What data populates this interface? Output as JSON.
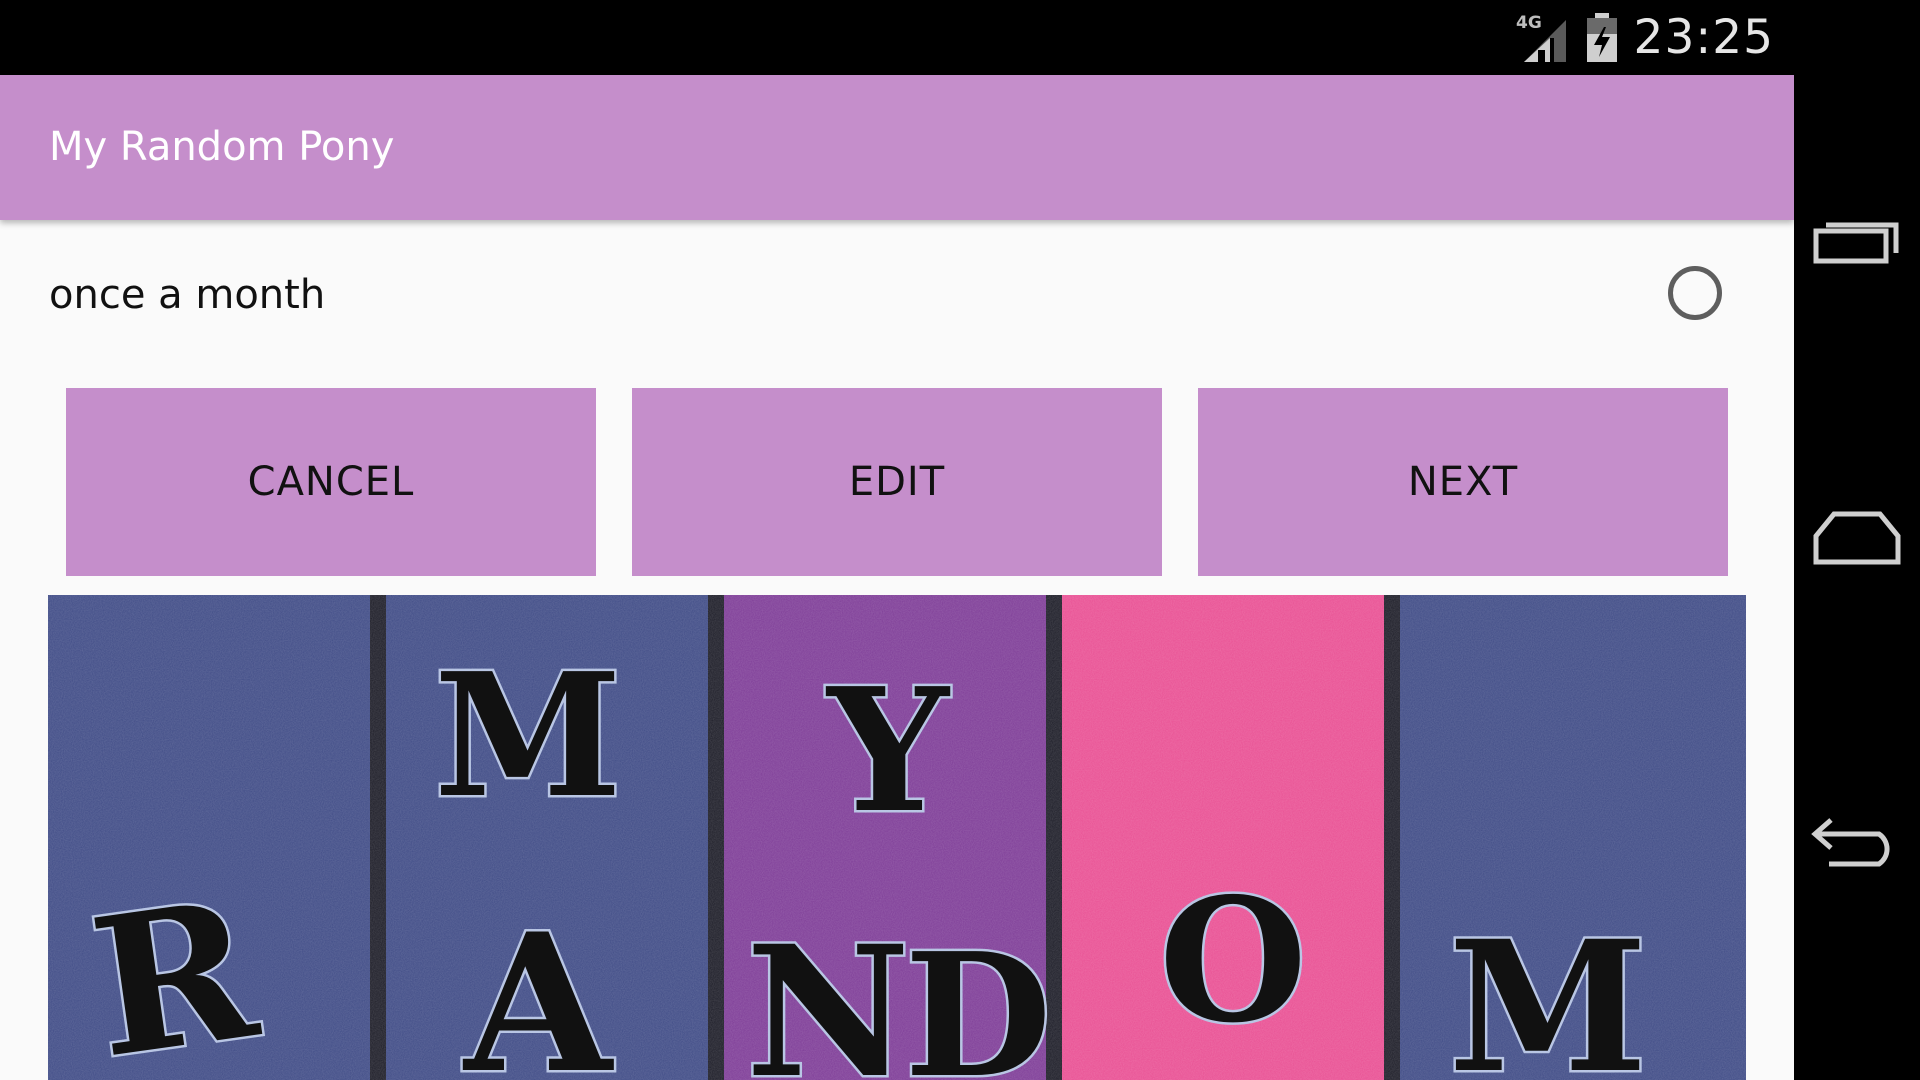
{
  "status_bar": {
    "network": "4G",
    "time": "23:25"
  },
  "toolbar": {
    "title": "My Random Pony"
  },
  "setting_row": {
    "label": "once a month",
    "selected": false
  },
  "buttons": {
    "cancel": "CANCEL",
    "edit": "EDIT",
    "next": "NEXT"
  },
  "banner": {
    "letters": [
      "M",
      "Y",
      "R",
      "A",
      "N",
      "D",
      "O",
      "M"
    ],
    "stripe_colors": [
      "#3f4b86",
      "#3f4b86",
      "#7e3c97",
      "#e94f93",
      "#3f4b86"
    ]
  },
  "nav": {
    "icons": [
      "recent-apps-icon",
      "home-icon",
      "back-icon"
    ]
  },
  "colors": {
    "accent": "#c58ecb",
    "background": "#fafafa"
  }
}
